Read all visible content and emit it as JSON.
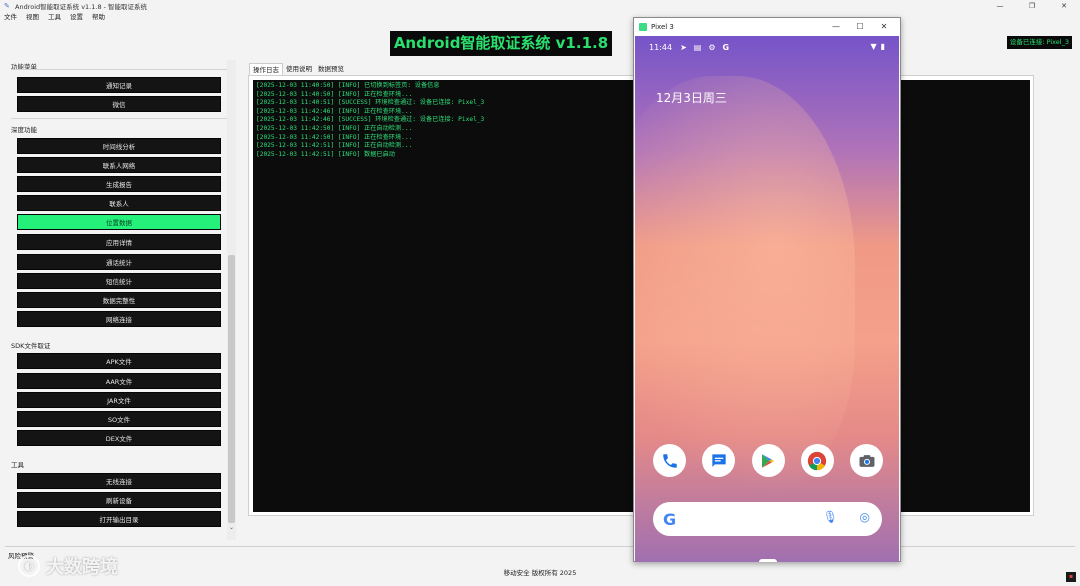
{
  "window": {
    "title": "Android智能取证系统 v1.1.8 - 智能取证系统",
    "controls": [
      "—",
      "❐",
      "✕"
    ]
  },
  "menu": [
    "文件",
    "视图",
    "工具",
    "设置",
    "帮助"
  ],
  "banner": "Android智能取证系统 v1.1.8",
  "device_status": "设备已连接: Pixel_3",
  "sidebar": {
    "section_func": "功能菜单",
    "func_items": [
      "通知记录",
      "微信"
    ],
    "section_adv": "深度功能",
    "adv_items": [
      "时间线分析",
      "联系人网络",
      "生成报告",
      "联系人",
      "位置数据",
      "应用详情",
      "通话统计",
      "短信统计",
      "数据完整性",
      "网络连接"
    ],
    "active_item": "位置数据",
    "section_sdk": "SDK文件取证",
    "sdk_items": [
      "APK文件",
      "AAR文件",
      "JAR文件",
      "SO文件",
      "DEX文件"
    ],
    "section_tools": "工具",
    "tool_items": [
      "无线连接",
      "刷新设备",
      "打开输出目录"
    ]
  },
  "tabs": [
    "操作日志",
    "使用说明",
    "数据预览"
  ],
  "log": [
    "[2025-12-03 11:40:50] [INFO] 已切换到标签页: 设备信息",
    "[2025-12-03 11:40:50] [INFO] 正在检查环境...",
    "[2025-12-03 11:40:51] [SUCCESS] 环境检查通过: 设备已连接: Pixel_3",
    "[2025-12-03 11:42:46] [INFO] 正在检查环境...",
    "[2025-12-03 11:42:46] [SUCCESS] 环境检查通过: 设备已连接: Pixel_3",
    "[2025-12-03 11:42:50] [INFO] 正在自动检测...",
    "[2025-12-03 11:42:50] [INFO] 正在检查环境...",
    "[2025-12-03 11:42:51] [INFO] 正在自动检测...",
    "[2025-12-03 11:42:51] [INFO] 数据已启动"
  ],
  "bottom": {
    "group_label": "风险预警",
    "footer": "移动安全 版权所有 2025",
    "watermark": "大数跨境"
  },
  "emulator": {
    "title": "Pixel 3",
    "controls": [
      "—",
      "☐",
      "✕"
    ],
    "time": "11:44",
    "date": "12月3日周三",
    "dock_apps": [
      "phone-icon",
      "messages-icon",
      "play-store-icon",
      "chrome-icon",
      "camera-icon"
    ],
    "search_logo": "G"
  },
  "colors": {
    "accent_green": "#25f07a",
    "log_text": "#2ee07a",
    "button_bg": "#141414"
  }
}
